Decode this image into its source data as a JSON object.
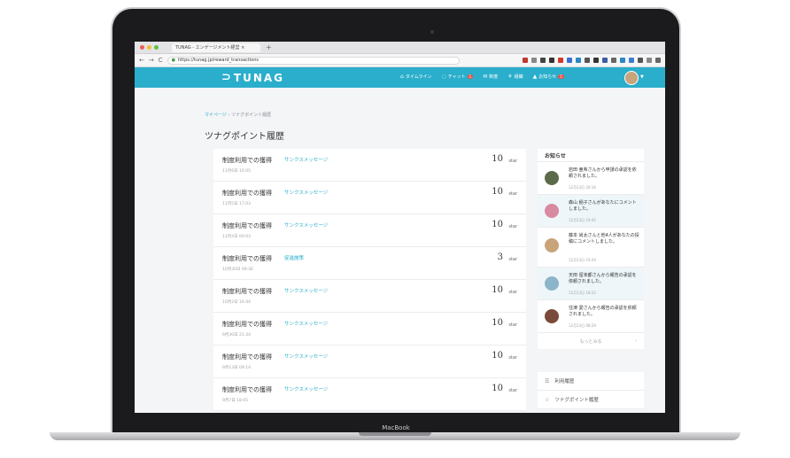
{
  "device": {
    "brand_label": "MacBook"
  },
  "browser": {
    "tab_title": "TUNAG - エンゲージメント経営 ×",
    "new_tab_symbol": "+",
    "url": "https://tunag.jp/reward_transactions",
    "back_symbol": "←",
    "forward_symbol": "→",
    "reload_symbol": "C"
  },
  "header": {
    "logo_text": "TUNAG",
    "nav": [
      {
        "label": "タイムライン",
        "icon": "home-icon",
        "glyph": "⌂",
        "badge": ""
      },
      {
        "label": "チャット",
        "icon": "chat-icon",
        "glyph": "◌",
        "badge": "1"
      },
      {
        "label": "制度",
        "icon": "mail-icon",
        "glyph": "✉",
        "badge": ""
      },
      {
        "label": "組織",
        "icon": "org-icon",
        "glyph": "⚘",
        "badge": ""
      },
      {
        "label": "お知らせ",
        "icon": "bell-icon",
        "glyph": "▲",
        "badge": "5"
      }
    ]
  },
  "breadcrumb": {
    "root": "マイページ",
    "separator": "›",
    "current": "ツナグポイント履歴"
  },
  "page_title": "ツナグポイント履歴",
  "transactions": [
    {
      "title": "制度利用での獲得",
      "category": "サンクスメッセージ",
      "date": "11月6日 10:05",
      "amount": "10",
      "unit": "star"
    },
    {
      "title": "制度利用での獲得",
      "category": "サンクスメッセージ",
      "date": "11月5日 17:03",
      "amount": "10",
      "unit": "star"
    },
    {
      "title": "制度利用での獲得",
      "category": "サンクスメッセージ",
      "date": "11月4日 00:03",
      "amount": "10",
      "unit": "star"
    },
    {
      "title": "制度利用での獲得",
      "category": "促進施策",
      "date": "10月30日 09:36",
      "amount": "3",
      "unit": "star"
    },
    {
      "title": "制度利用での獲得",
      "category": "サンクスメッセージ",
      "date": "10月2日 16:44",
      "amount": "10",
      "unit": "star"
    },
    {
      "title": "制度利用での獲得",
      "category": "サンクスメッセージ",
      "date": "9月30日 21:34",
      "amount": "10",
      "unit": "star"
    },
    {
      "title": "制度利用での獲得",
      "category": "サンクスメッセージ",
      "date": "9月13日 09:14",
      "amount": "10",
      "unit": "star"
    },
    {
      "title": "制度利用での獲得",
      "category": "サンクスメッセージ",
      "date": "9月7日 18:05",
      "amount": "10",
      "unit": "star"
    }
  ],
  "notices": {
    "heading": "お知らせ",
    "items": [
      {
        "text": "岩田 亜希さんから申請の承認を依頼されました。",
        "time": "12月13日 20:16",
        "avatar_color": "#5b6b4a"
      },
      {
        "text": "森山 稲子さんがあなたにコメントしました。",
        "time": "12月13日 19:45",
        "avatar_color": "#d98aa0"
      },
      {
        "text": "藤本 尚太さんと他4人があなたの投稿にコメントしました。",
        "time": "12月13日 19:29",
        "avatar_color": "#c9a37a"
      },
      {
        "text": "天田 留未都さんから報告の承認を依頼されました。",
        "time": "12月13日 18:22",
        "avatar_color": "#8db5c9"
      },
      {
        "text": "住津 愛さんから報告の承認を依頼されました。",
        "time": "12月13日 08:29",
        "avatar_color": "#7a4a3a"
      }
    ],
    "more_label": "もっとみる",
    "more_chevron": "›"
  },
  "side_menu": [
    {
      "label": "利用履歴",
      "icon": "list-icon",
      "glyph": "☰"
    },
    {
      "label": "ツナグポイント履歴",
      "icon": "star-icon",
      "glyph": "☆"
    }
  ]
}
